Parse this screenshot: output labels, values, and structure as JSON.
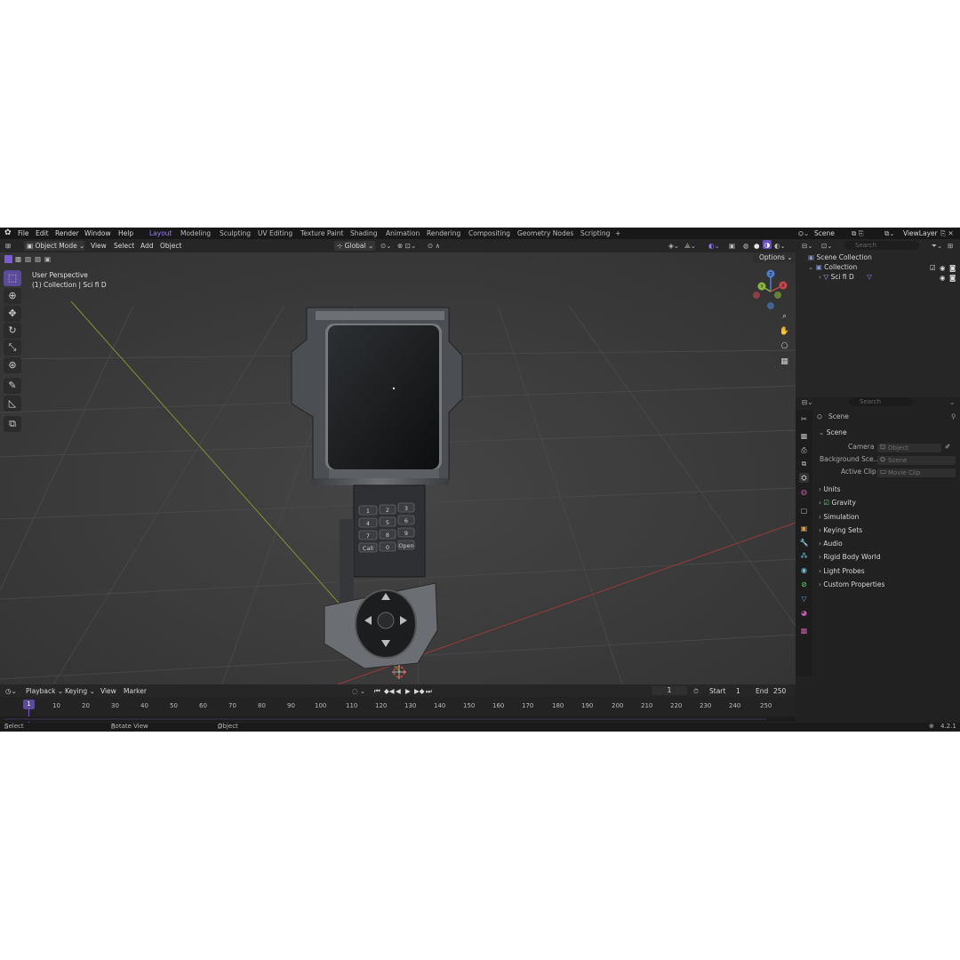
{
  "topbar": {
    "menu": [
      "File",
      "Edit",
      "Render",
      "Window",
      "Help"
    ],
    "workspaces": [
      "Layout",
      "Modeling",
      "Sculpting",
      "UV Editing",
      "Texture Paint",
      "Shading",
      "Animation",
      "Rendering",
      "Compositing",
      "Geometry Nodes",
      "Scripting"
    ],
    "active_workspace": "Layout",
    "add_tab": "+",
    "scene_label": "Scene",
    "viewlayer_label": "ViewLayer"
  },
  "viewport_header": {
    "mode": "Object Mode",
    "menus": [
      "View",
      "Select",
      "Add",
      "Object"
    ],
    "orientation": "Global",
    "options": "Options"
  },
  "viewport": {
    "view_name": "User Perspective",
    "collection_info": "(1) Collection | Sci fi D",
    "gizmo_axes": [
      "Z",
      "Y",
      "X"
    ],
    "keypad": [
      "1",
      "2",
      "3",
      "4",
      "5",
      "6",
      "7",
      "8",
      "9",
      "Call",
      "0",
      "Open"
    ]
  },
  "timeline": {
    "menus": [
      "Playback",
      "Keying",
      "View",
      "Marker"
    ],
    "current_frame": "1",
    "start_label": "Start",
    "start_value": "1",
    "end_label": "End",
    "end_value": "250",
    "ruler": [
      "1",
      "10",
      "20",
      "30",
      "40",
      "50",
      "60",
      "70",
      "80",
      "90",
      "100",
      "110",
      "120",
      "130",
      "140",
      "150",
      "160",
      "170",
      "180",
      "190",
      "200",
      "210",
      "220",
      "230",
      "240",
      "250"
    ]
  },
  "status_bar": {
    "select": "Select",
    "rotate": "Rotate View",
    "object": "Object",
    "version": "4.2.1"
  },
  "outliner": {
    "search_placeholder": "Search",
    "scene_collection": "Scene Collection",
    "collection": "Collection",
    "object": "Sci fi D"
  },
  "properties": {
    "search_placeholder": "Search",
    "breadcrumb": "Scene",
    "section": "Scene",
    "fields": [
      {
        "label": "Camera",
        "placeholder": "Object"
      },
      {
        "label": "Background Sce...",
        "placeholder": "Scene"
      },
      {
        "label": "Active Clip",
        "placeholder": "Movie Clip"
      }
    ],
    "panels": [
      "Units",
      "Gravity",
      "Simulation",
      "Keying Sets",
      "Audio",
      "Rigid Body World",
      "Light Probes",
      "Custom Properties"
    ]
  },
  "colors": {
    "accent": "#7b5cd6",
    "active_tab_text": "#9d7cff",
    "axis_x": "#c8474e",
    "axis_y": "#8bb83a",
    "axis_z": "#4c7fd1",
    "viewport_bg": "#3d3d3d"
  }
}
